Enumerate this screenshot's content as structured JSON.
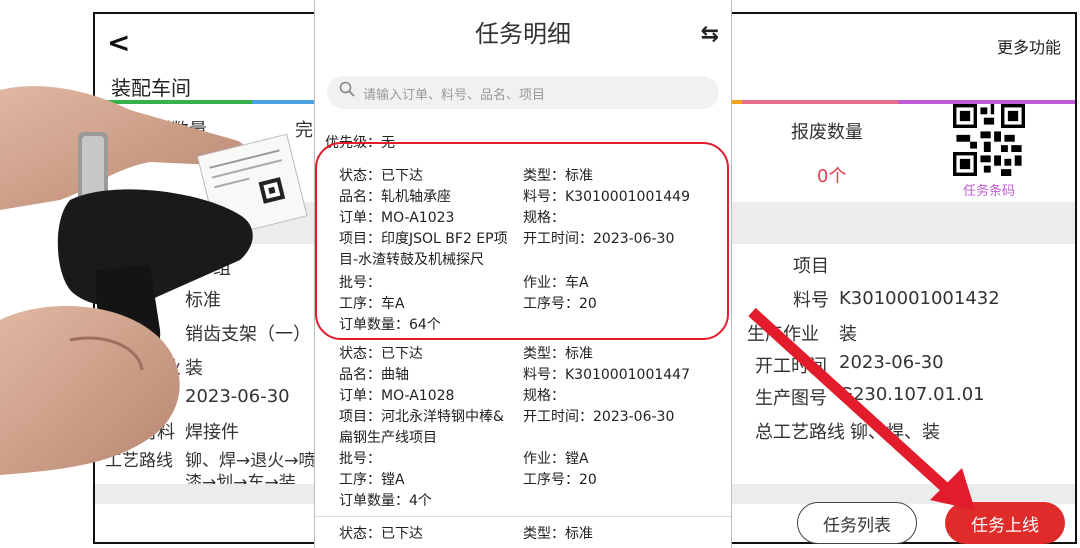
{
  "background": {
    "back_label": "<",
    "more_label": "更多功能",
    "workshop_title": "装配车间",
    "col_plan": "计划数量",
    "col_done": "完",
    "scrap_label": "报废数量",
    "scrap_value": "0个",
    "qr_label": "任务条码",
    "left_rows": [
      {
        "label": "组",
        "value": ""
      },
      {
        "label": "标准",
        "value": ""
      },
      {
        "label": "销齿支架（一）",
        "value": ""
      },
      {
        "label": "业",
        "value": "装"
      },
      {
        "label": "间",
        "value": "2023-06-30"
      },
      {
        "label": "材料",
        "value": "焊接件"
      },
      {
        "label": "工艺路线",
        "value": "铆、焊→退火→喷"
      },
      {
        "label": "",
        "value": "漆→划→车→装"
      }
    ],
    "right_rows": [
      {
        "label": "项目",
        "value": ""
      },
      {
        "label": "料号",
        "value": "K3010001001432"
      },
      {
        "label": "生产作业",
        "value": "装"
      },
      {
        "label": "开工时间",
        "value": "2023-06-30"
      },
      {
        "label": "生产图号",
        "value": "G230.107.01.01"
      },
      {
        "label": "总工艺路线",
        "value": "铆、焊、装"
      }
    ],
    "btn_task_list": "任务列表",
    "btn_task_online": "任务上线"
  },
  "phone": {
    "title": "任务明细",
    "search_placeholder": "请输入订单、料号、品名、项目",
    "priority": "优先级：无",
    "cards": [
      {
        "status": "状态：已下达",
        "type": "类型：标准",
        "name": "品名：轧机轴承座",
        "part_no": "料号：K3010001001449",
        "order": "订单：MO-A1023",
        "spec": "规格：",
        "project_line1": "项目：印度JSOL BF2 EP项",
        "start_time": "开工时间：2023-06-30",
        "project_line2": "目-水渣转鼓及机械探尺",
        "batch": "批号：",
        "job": "作业：车A",
        "process": "工序：车A",
        "process_no": "工序号：20",
        "qty": "订单数量：64个"
      },
      {
        "status": "状态：已下达",
        "type": "类型：标准",
        "name": "品名：曲轴",
        "part_no": "料号：K3010001001447",
        "order": "订单：MO-A1028",
        "spec": "规格：",
        "project_line1": "项目：河北永洋特钢中棒&",
        "start_time": "开工时间：2023-06-30",
        "project_line2": "扁钢生产线项目",
        "batch": "批号：",
        "job": "作业：镗A",
        "process": "工序：镗A",
        "process_no": "工序号：20",
        "qty": "订单数量：4个"
      },
      {
        "status": "状态：已下达",
        "type": "类型：标准"
      }
    ]
  },
  "colors": {
    "accent_red": "#e02b2b",
    "highlight_red": "#e31c2c",
    "qr_purple": "#c05ad6"
  },
  "icons": [
    "back-arrow-icon",
    "swap-icon",
    "search-icon",
    "qr-code-icon",
    "red-arrow-icon",
    "barcode-scanner-photo"
  ]
}
